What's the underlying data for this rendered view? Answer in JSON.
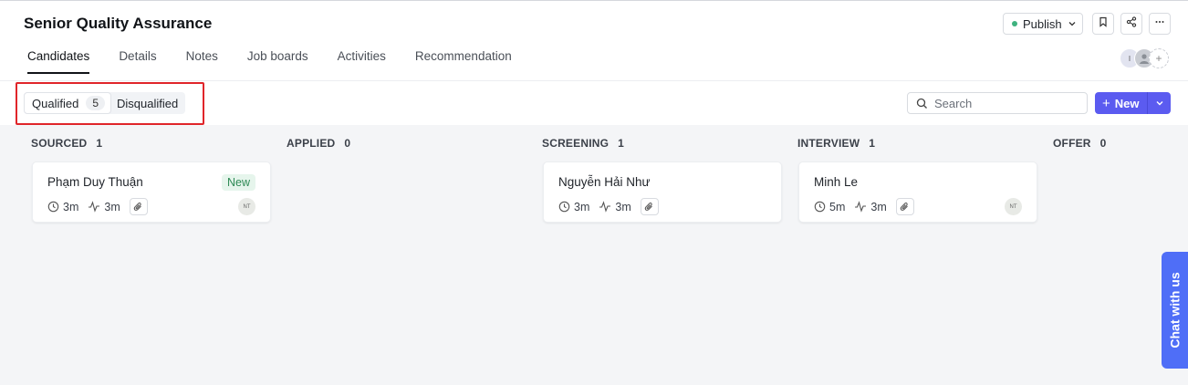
{
  "job": {
    "title": "Senior Quality Assurance"
  },
  "actions": {
    "publish_label": "Publish"
  },
  "tabs": [
    "Candidates",
    "Details",
    "Notes",
    "Job boards",
    "Activities",
    "Recommendation"
  ],
  "avatars": {
    "first_initial": "I"
  },
  "filter": {
    "qualified_label": "Qualified",
    "qualified_count": "5",
    "disqualified_label": "Disqualified"
  },
  "search": {
    "placeholder": "Search"
  },
  "new_button": {
    "label": "New"
  },
  "columns": [
    {
      "title": "SOURCED",
      "count": "1"
    },
    {
      "title": "APPLIED",
      "count": "0"
    },
    {
      "title": "SCREENING",
      "count": "1"
    },
    {
      "title": "INTERVIEW",
      "count": "1"
    },
    {
      "title": "OFFER",
      "count": "0"
    }
  ],
  "cards": [
    {
      "name": "Phạm Duy Thuận",
      "badge": "New",
      "time": "3m",
      "activity": "3m",
      "owner": "NT"
    },
    {
      "name": "Nguyễn Hải Như",
      "time": "3m",
      "activity": "3m"
    },
    {
      "name": "Minh Le",
      "time": "5m",
      "activity": "3m",
      "owner": "NT"
    }
  ],
  "chat": {
    "label": "Chat with us"
  },
  "colors": {
    "accent": "#5b5bf0",
    "chat": "#4f6ef7",
    "highlight": "#e0252a",
    "badge_green": "#2e8a55"
  }
}
